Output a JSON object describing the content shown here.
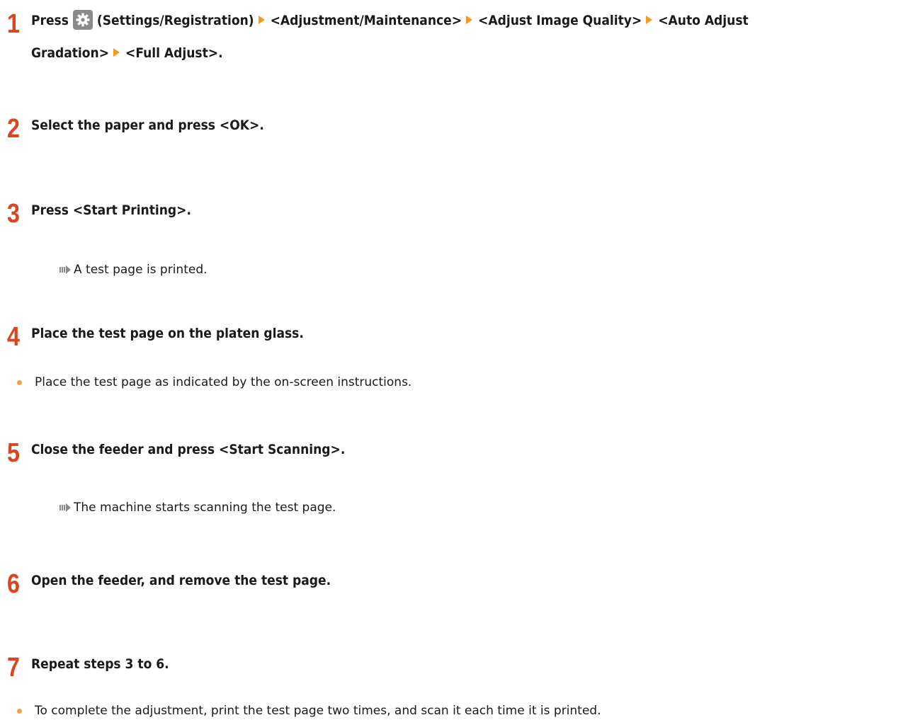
{
  "steps": [
    {
      "number": "1",
      "title_parts": {
        "press": "Press",
        "settings_label": "(Settings/Registration)",
        "path1": "<Adjustment/Maintenance>",
        "path2": "<Adjust Image Quality>",
        "path3": "<Auto Adjust",
        "path3b": "Gradation>",
        "path4": "<Full Adjust>."
      }
    },
    {
      "number": "2",
      "title": "Select the paper and press <OK>."
    },
    {
      "number": "3",
      "title": "Press <Start Printing>.",
      "result": "A test page is printed."
    },
    {
      "number": "4",
      "title": "Place the test page on the platen glass.",
      "bullet": "Place the test page as indicated by the on-screen instructions."
    },
    {
      "number": "5",
      "title": "Close the feeder and press <Start Scanning>.",
      "result": "The machine starts scanning the test page."
    },
    {
      "number": "6",
      "title": "Open the feeder, and remove the test page."
    },
    {
      "number": "7",
      "title": "Repeat steps 3 to 6.",
      "bullet": "To complete the adjustment, print the test page two times, and scan it each time it is printed."
    }
  ],
  "icons": {
    "settings": "gear-icon",
    "menu_arrow": "right-triangle-icon",
    "result_arrow": "result-arrow-icon"
  },
  "colors": {
    "step_number": "#d6461f",
    "menu_arrow": "#f29a1d",
    "bullet": "#f2a23a",
    "icon_bg": "#8a8a8a"
  }
}
